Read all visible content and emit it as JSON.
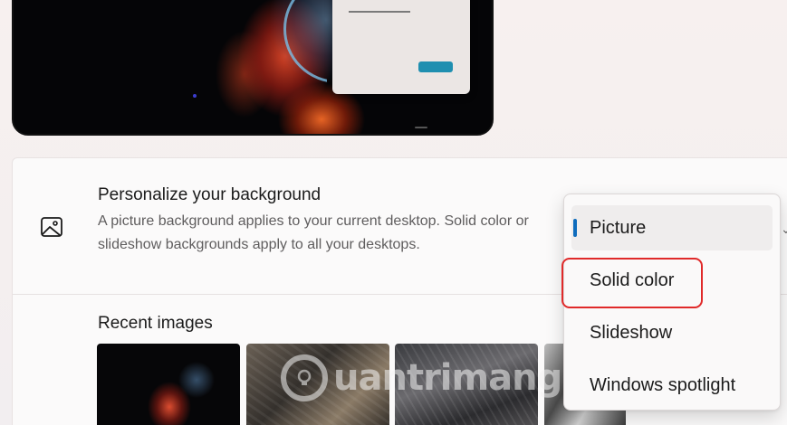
{
  "preview": {
    "accent_color": "#1f8fb0"
  },
  "background_setting": {
    "title": "Personalize your background",
    "description": "A picture background applies to your current desktop. Solid color or slideshow backgrounds apply to all your desktops.",
    "icon": "image-icon"
  },
  "recent_images": {
    "title": "Recent images"
  },
  "dropdown": {
    "selected": "Picture",
    "options": [
      {
        "label": "Picture"
      },
      {
        "label": "Solid color"
      },
      {
        "label": "Slideshow"
      },
      {
        "label": "Windows spotlight"
      }
    ],
    "accent_color": "#0f6cbd",
    "highlight_color": "#e02a2a"
  },
  "watermark": {
    "text": "uantrimang"
  }
}
